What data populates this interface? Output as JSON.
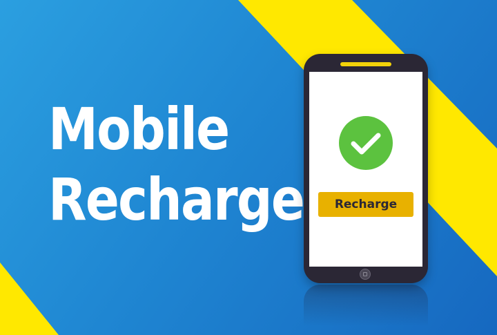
{
  "headline": {
    "line1": "Mobile",
    "line2": "Recharge"
  },
  "phone": {
    "status_icon": "check-circle-icon",
    "button_label": "Recharge",
    "home_button_icon": "home-button-icon"
  },
  "colors": {
    "background_blue": "#1f86d2",
    "stripe_yellow": "#ffe800",
    "phone_body": "#2b2735",
    "check_green": "#5cc23f",
    "button_gold": "#e8b100",
    "text_white": "#ffffff"
  }
}
